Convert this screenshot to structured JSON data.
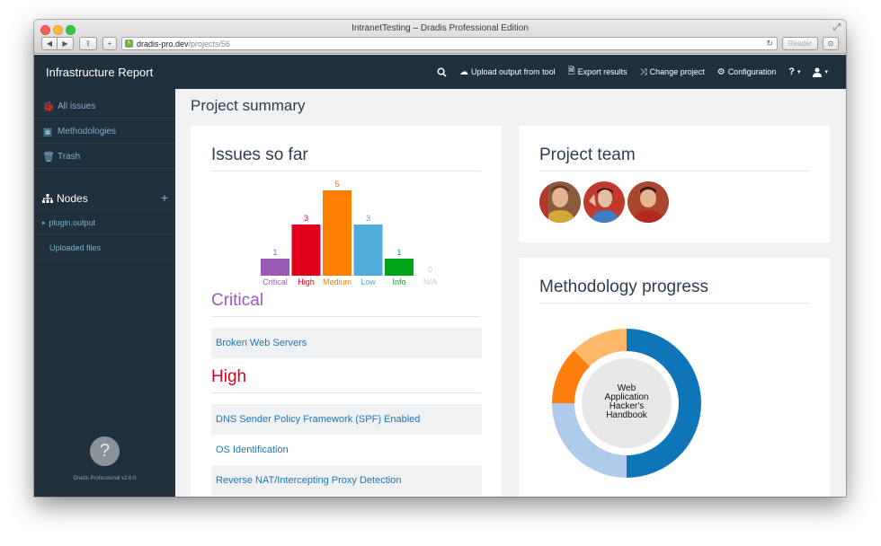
{
  "window": {
    "title": "IntranetTesting – Dradis Professional Edition",
    "url_host": "dradis-pro.dev",
    "url_path": "/projects/56",
    "reader_label": "Reader"
  },
  "navbar": {
    "brand": "Infrastructure Report",
    "links": [
      {
        "icon": "upload-cloud-icon",
        "label": "Upload output from tool"
      },
      {
        "icon": "export-icon",
        "label": "Export results"
      },
      {
        "icon": "shuffle-icon",
        "label": "Change project"
      },
      {
        "icon": "gear-icon",
        "label": "Configuration"
      }
    ],
    "help_label": "?",
    "user_icon": "user-icon"
  },
  "sidebar": {
    "items": [
      {
        "icon": "bug-icon",
        "label": "All issues"
      },
      {
        "icon": "book-icon",
        "label": "Methodologies"
      },
      {
        "icon": "trash-icon",
        "label": "Trash"
      }
    ],
    "nodes_label": "Nodes",
    "nodes": [
      {
        "label": "plugin.output"
      },
      {
        "label": "Uploaded files"
      }
    ],
    "help_glyph": "?",
    "version": "Dradis Professional v2.6.0"
  },
  "main": {
    "title": "Project summary",
    "issues_title": "Issues so far",
    "sections": [
      {
        "heading": "Critical",
        "issues": [
          "Broken Web Servers"
        ]
      },
      {
        "heading": "High",
        "issues": [
          "DNS Sender Policy Framework (SPF) Enabled",
          "OS Identification",
          "Reverse NAT/Intercepting Proxy Detection"
        ]
      }
    ],
    "team_title": "Project team",
    "methodology_title": "Methodology progress",
    "methodology_name": [
      "Web",
      "Application",
      "Hacker's",
      "Handbook"
    ]
  },
  "chart_data": {
    "type": "bar",
    "categories": [
      "Critical",
      "High",
      "Medium",
      "Low",
      "Info",
      "N/A"
    ],
    "values": [
      1,
      3,
      5,
      3,
      1,
      0
    ],
    "colors": [
      "#9b59b6",
      "#e0001b",
      "#ff7f00",
      "#52acdb",
      "#00a517",
      "#cccccc"
    ]
  },
  "methodology_chart": {
    "type": "pie",
    "values": [
      50,
      25,
      12.5,
      12.5
    ],
    "colors": [
      "#0e75b8",
      "#aecbeb",
      "#ff7f0e",
      "#fdb86a"
    ]
  }
}
